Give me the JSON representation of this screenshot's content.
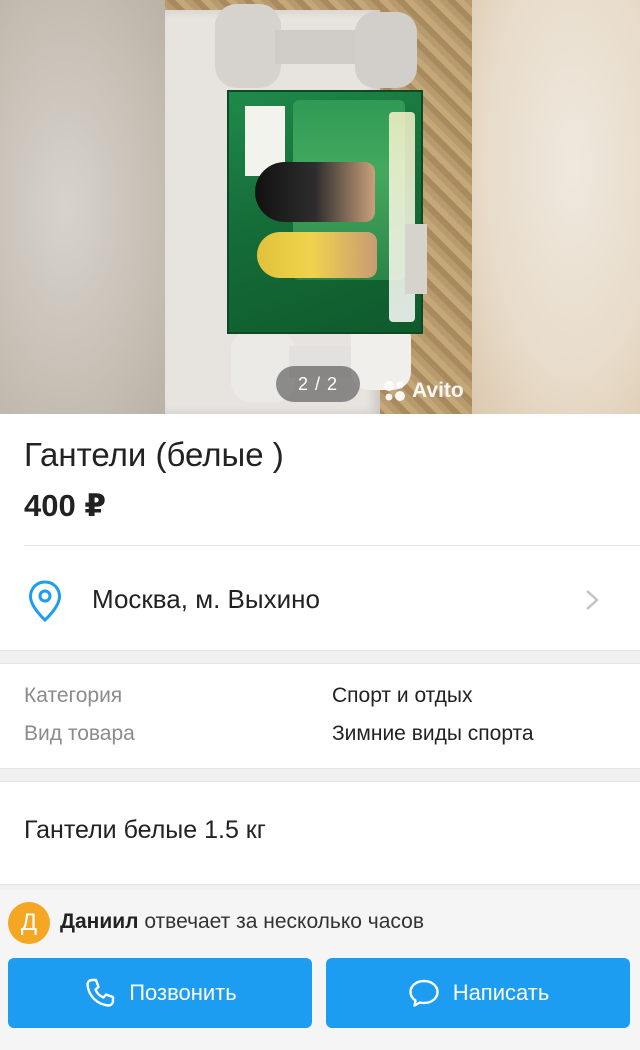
{
  "gallery": {
    "counter": "2 / 2",
    "watermark": "Avito",
    "photo_alt": "dumbbells photo"
  },
  "listing": {
    "title": "Гантели (белые )",
    "price": "400 ₽"
  },
  "location": {
    "icon": "location-pin-icon",
    "text": "Москва, м. Выхино"
  },
  "params": [
    {
      "key": "Категория",
      "value": "Спорт и отдых"
    },
    {
      "key": "Вид товара",
      "value": "Зимние виды спорта"
    }
  ],
  "description": "Гантели белые 1.5 кг",
  "seller": {
    "avatar_letter": "Д",
    "name": "Даниил",
    "response": "отвечает за несколько часов"
  },
  "actions": {
    "call_label": "Позвонить",
    "write_label": "Написать"
  },
  "colors": {
    "accent": "#1c9df2",
    "avatar": "#f5a623",
    "pin": "#1c9df2"
  }
}
